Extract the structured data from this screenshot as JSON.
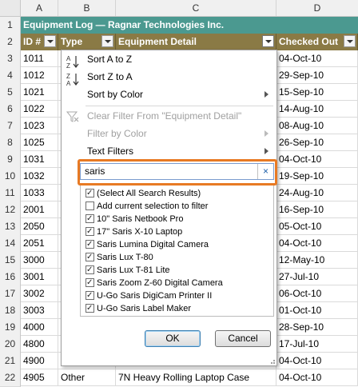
{
  "columns": [
    "A",
    "B",
    "C",
    "D"
  ],
  "title": "Equipment Log — Ragnar Technologies Inc.",
  "headers": {
    "id": "ID #",
    "type": "Type",
    "detail": "Equipment Detail",
    "checked": "Checked Out"
  },
  "rows": [
    {
      "num": "1"
    },
    {
      "num": "2"
    },
    {
      "num": "3",
      "id": "1011",
      "type": "",
      "detail": "",
      "date": "04-Oct-10"
    },
    {
      "num": "4",
      "id": "1012",
      "type": "",
      "detail": "",
      "date": "29-Sep-10"
    },
    {
      "num": "5",
      "id": "1021",
      "type": "",
      "detail": "",
      "date": "15-Sep-10"
    },
    {
      "num": "6",
      "id": "1022",
      "type": "",
      "detail": "",
      "date": "14-Aug-10"
    },
    {
      "num": "7",
      "id": "1023",
      "type": "",
      "detail": "",
      "date": "08-Aug-10"
    },
    {
      "num": "8",
      "id": "1025",
      "type": "",
      "detail": "",
      "date": "26-Sep-10"
    },
    {
      "num": "9",
      "id": "1031",
      "type": "",
      "detail": "",
      "date": "04-Oct-10"
    },
    {
      "num": "10",
      "id": "1032",
      "type": "",
      "detail": "",
      "date": "19-Sep-10"
    },
    {
      "num": "11",
      "id": "1033",
      "type": "",
      "detail": "",
      "date": "24-Aug-10"
    },
    {
      "num": "12",
      "id": "2001",
      "type": "",
      "detail": "",
      "date": "16-Sep-10"
    },
    {
      "num": "13",
      "id": "2050",
      "type": "",
      "detail": "",
      "date": "05-Oct-10"
    },
    {
      "num": "14",
      "id": "2051",
      "type": "",
      "detail": "",
      "date": "04-Oct-10"
    },
    {
      "num": "15",
      "id": "3000",
      "type": "",
      "detail": "",
      "date": "12-May-10"
    },
    {
      "num": "16",
      "id": "3001",
      "type": "",
      "detail": "",
      "date": "27-Jul-10"
    },
    {
      "num": "17",
      "id": "3002",
      "type": "",
      "detail": "",
      "date": "06-Oct-10"
    },
    {
      "num": "18",
      "id": "3003",
      "type": "",
      "detail": "",
      "date": "01-Oct-10"
    },
    {
      "num": "19",
      "id": "4000",
      "type": "",
      "detail": "",
      "date": "28-Sep-10"
    },
    {
      "num": "20",
      "id": "4800",
      "type": "",
      "detail": "",
      "date": "17-Jul-10"
    },
    {
      "num": "21",
      "id": "4900",
      "type": "",
      "detail": "",
      "date": "04-Oct-10"
    },
    {
      "num": "22",
      "id": "4905",
      "type": "Other",
      "detail": "7N Heavy Rolling Laptop Case",
      "date": "04-Oct-10"
    }
  ],
  "menu": {
    "sort_az": "Sort A to Z",
    "sort_za": "Sort Z to A",
    "sort_color": "Sort by Color",
    "clear_filter": "Clear Filter From \"Equipment Detail\"",
    "filter_color": "Filter by Color",
    "text_filters": "Text Filters",
    "search_value": "saris",
    "clear_search": "×",
    "items": [
      {
        "label": "(Select All Search Results)",
        "checked": true
      },
      {
        "label": "Add current selection to filter",
        "checked": false
      },
      {
        "label": "10\" Saris Netbook Pro",
        "checked": true
      },
      {
        "label": "17\" Saris X-10 Laptop",
        "checked": true
      },
      {
        "label": "Saris Lumina Digital Camera",
        "checked": true
      },
      {
        "label": "Saris Lux T-80",
        "checked": true
      },
      {
        "label": "Saris Lux T-81 Lite",
        "checked": true
      },
      {
        "label": "Saris Zoom Z-60 Digital Camera",
        "checked": true
      },
      {
        "label": "U-Go Saris DigiCam Printer II",
        "checked": true
      },
      {
        "label": "U-Go Saris Label Maker",
        "checked": true
      }
    ],
    "ok": "OK",
    "cancel": "Cancel"
  },
  "colors": {
    "title_bg": "#4b9990",
    "header_bg": "#8a7a45",
    "highlight": "#e87a24"
  },
  "icons": {
    "sort_az": "sort-az-icon",
    "sort_za": "sort-za-icon",
    "clear_filter": "funnel-clear-icon"
  }
}
